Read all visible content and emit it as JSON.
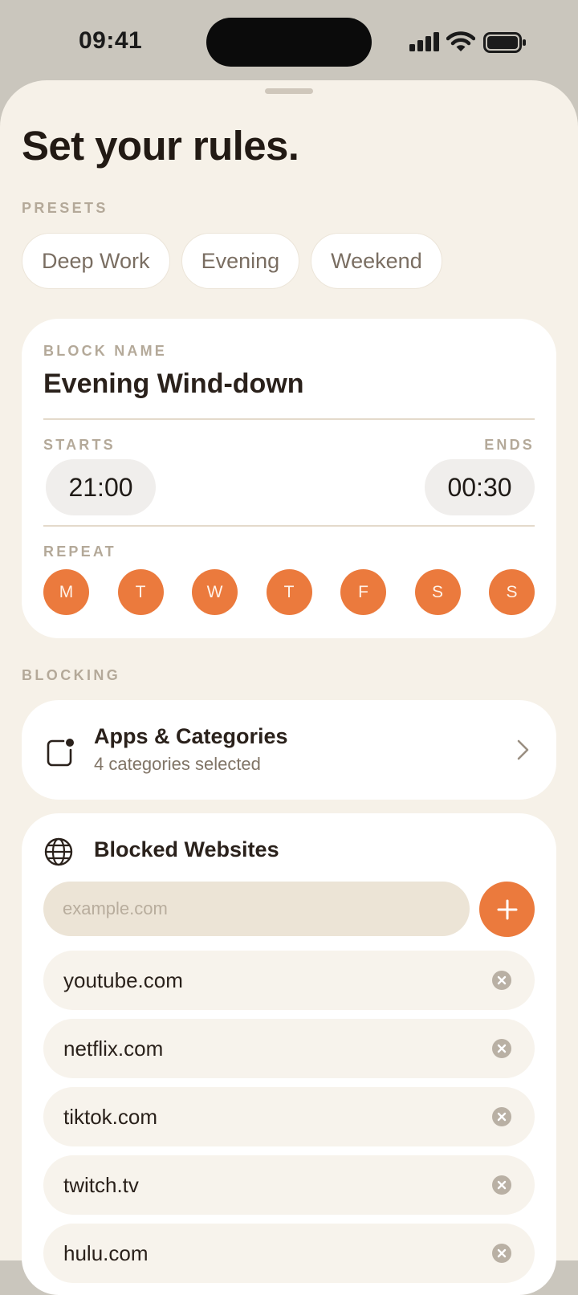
{
  "status_bar": {
    "time": "09:41"
  },
  "title": "Set your rules.",
  "presets": {
    "label": "PRESETS",
    "items": [
      "Deep Work",
      "Evening",
      "Weekend"
    ]
  },
  "block": {
    "name_label": "BLOCK NAME",
    "name": "Evening Wind-down",
    "starts_label": "STARTS",
    "ends_label": "ENDS",
    "start_time": "21:00",
    "end_time": "00:30",
    "repeat_label": "REPEAT",
    "days": [
      "M",
      "T",
      "W",
      "T",
      "F",
      "S",
      "S"
    ]
  },
  "blocking": {
    "label": "BLOCKING",
    "apps_title": "Apps & Categories",
    "apps_subtitle": "4 categories selected"
  },
  "websites": {
    "title": "Blocked Websites",
    "input_placeholder": "example.com",
    "items": [
      "youtube.com",
      "netflix.com",
      "tiktok.com",
      "twitch.tv",
      "hulu.com"
    ]
  },
  "colors": {
    "accent": "#eb7a3d",
    "sheet_background": "#f6f1e8",
    "card": "#ffffff",
    "muted_label": "#b4a999"
  }
}
